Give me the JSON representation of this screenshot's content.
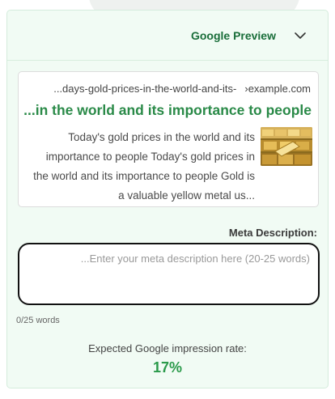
{
  "header": {
    "title": "Google Preview",
    "toggle_icon": "chevron-down-icon"
  },
  "preview": {
    "url_path": "...days-gold-prices-in-the-world-and-its-",
    "url_domain": "›example.com",
    "title": "...in the world and its importance to people",
    "snippet": "Today's gold prices in the world and its importance to people Today's gold prices in the world and its importance to people Gold is a valuable yellow metal us...",
    "thumbnail": "gold-bars-image"
  },
  "meta": {
    "label": "Meta Description:",
    "value": "",
    "placeholder": "...Enter your meta description here (20-25 words)",
    "word_count": "0/25 words"
  },
  "impression": {
    "label": "Expected Google impression rate:",
    "value": "17%"
  },
  "colors": {
    "accent": "#2a9a4a",
    "title": "#1a6e3a",
    "panel_bg": "#f1fbf4"
  }
}
